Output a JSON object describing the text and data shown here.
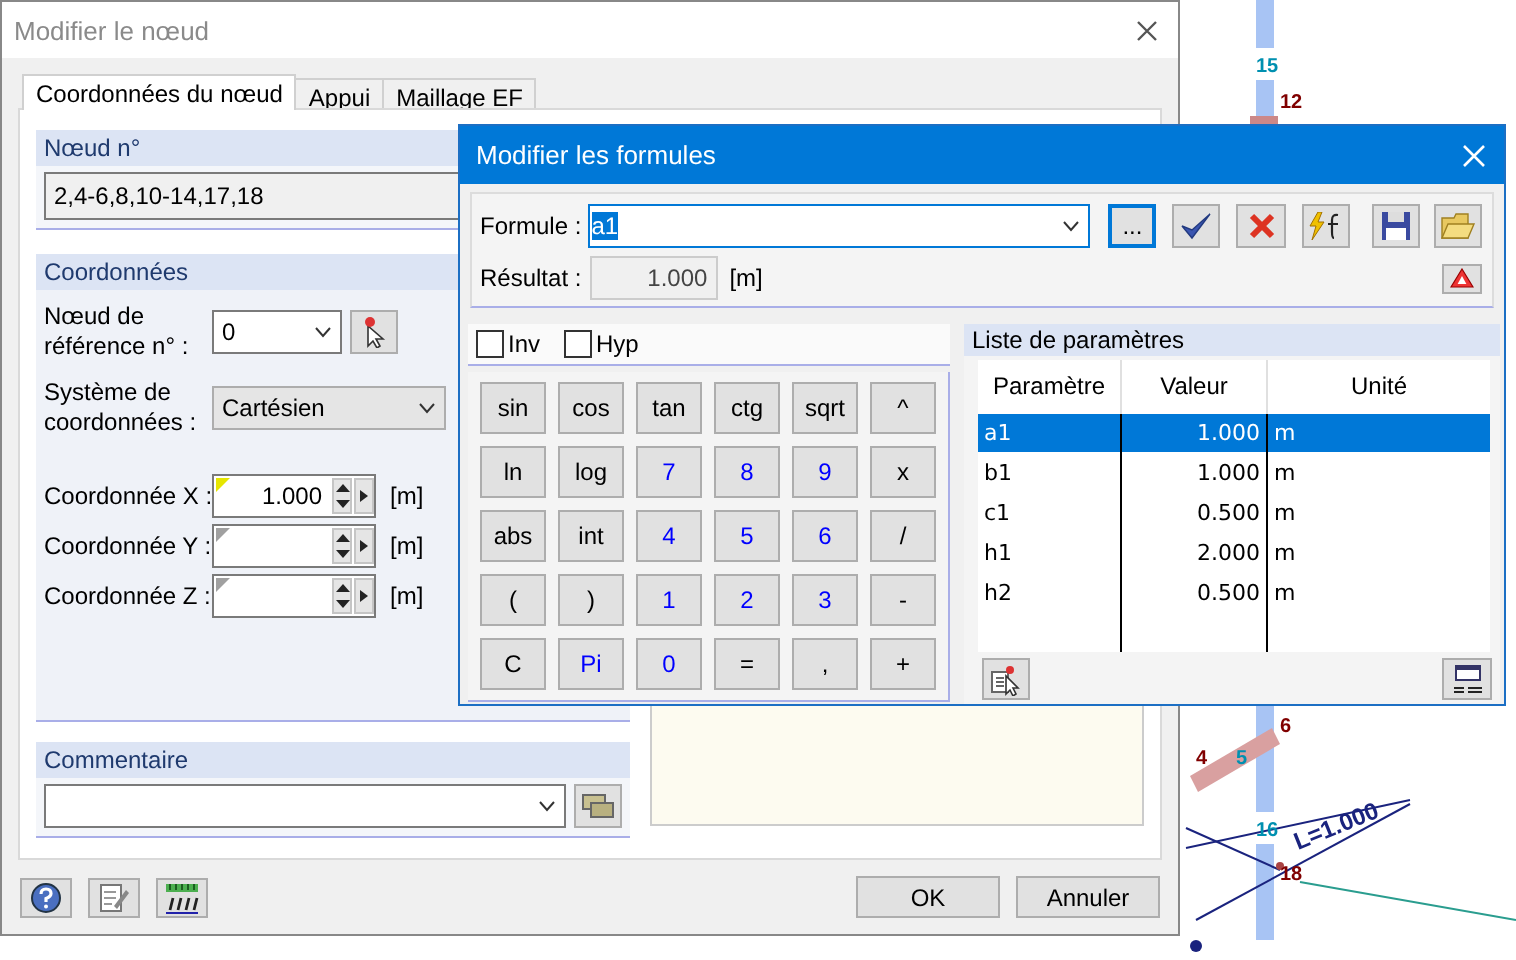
{
  "model_view": {
    "labels": [
      {
        "text": "15",
        "kind": "node"
      },
      {
        "text": "12",
        "kind": "member"
      },
      {
        "text": "6",
        "kind": "member"
      },
      {
        "text": "4",
        "kind": "member"
      },
      {
        "text": "5",
        "kind": "node"
      },
      {
        "text": "16",
        "kind": "node"
      },
      {
        "text": "18",
        "kind": "member"
      },
      {
        "text": "L=1.000",
        "kind": "dimension"
      }
    ]
  },
  "node_dialog": {
    "title": "Modifier le nœud",
    "tabs": [
      {
        "label": "Coordonnées du nœud",
        "selected": true
      },
      {
        "label": "Appui",
        "selected": false
      },
      {
        "label": "Maillage EF",
        "selected": false
      }
    ],
    "node_number": {
      "heading": "Nœud n°",
      "value": "2,4-6,8,10-14,17,18"
    },
    "coordinates": {
      "heading": "Coordonnées",
      "reference_node": {
        "label": "Nœud de référence n° :",
        "value": "0"
      },
      "system": {
        "label": "Système de coordonnées :",
        "value": "Cartésien"
      },
      "fields": [
        {
          "label": "Coordonnée X :",
          "value": "1.000",
          "unit": "[m]",
          "edited": true
        },
        {
          "label": "Coordonnée Y :",
          "unit": "[m]",
          "edited": false
        },
        {
          "label": "Coordonnée Z :",
          "unit": "[m]",
          "edited": false
        }
      ]
    },
    "comment": {
      "heading": "Commentaire"
    },
    "buttons": [
      "OK",
      "Annuler"
    ]
  },
  "formula_dialog": {
    "title": "Modifier les formules",
    "formula": {
      "label": "Formule :",
      "value": "a1"
    },
    "browse_button": "...",
    "result": {
      "label": "Résultat :",
      "value": "1.000",
      "unit": "[m]"
    },
    "options": [
      {
        "label": "Inv",
        "checked": false
      },
      {
        "label": "Hyp",
        "checked": false
      }
    ],
    "keys": [
      {
        "label": "sin",
        "kind": "function"
      },
      {
        "label": "cos",
        "kind": "function"
      },
      {
        "label": "tan",
        "kind": "function"
      },
      {
        "label": "ctg",
        "kind": "function"
      },
      {
        "label": "sqrt",
        "kind": "function"
      },
      {
        "label": "^",
        "kind": "operator"
      },
      {
        "label": "ln",
        "kind": "function"
      },
      {
        "label": "log",
        "kind": "function"
      },
      {
        "label": "7",
        "kind": "digit"
      },
      {
        "label": "8",
        "kind": "digit"
      },
      {
        "label": "9",
        "kind": "digit"
      },
      {
        "label": "x",
        "kind": "operator"
      },
      {
        "label": "abs",
        "kind": "function"
      },
      {
        "label": "int",
        "kind": "function"
      },
      {
        "label": "4",
        "kind": "digit"
      },
      {
        "label": "5",
        "kind": "digit"
      },
      {
        "label": "6",
        "kind": "digit"
      },
      {
        "label": "/",
        "kind": "operator"
      },
      {
        "label": "(",
        "kind": "operator"
      },
      {
        "label": ")",
        "kind": "operator"
      },
      {
        "label": "1",
        "kind": "digit"
      },
      {
        "label": "2",
        "kind": "digit"
      },
      {
        "label": "3",
        "kind": "digit"
      },
      {
        "label": "-",
        "kind": "operator"
      },
      {
        "label": "C",
        "kind": "function"
      },
      {
        "label": "Pi",
        "kind": "digit"
      },
      {
        "label": "0",
        "kind": "digit"
      },
      {
        "label": "=",
        "kind": "operator"
      },
      {
        "label": ",",
        "kind": "operator"
      },
      {
        "label": "+",
        "kind": "operator"
      }
    ],
    "parameters": {
      "heading": "Liste de paramètres",
      "columns": [
        "Paramètre",
        "Valeur",
        "Unité"
      ],
      "rows": [
        {
          "cells": [
            "a1",
            "1.000",
            "m"
          ],
          "selected": true
        },
        {
          "cells": [
            "b1",
            "1.000",
            "m"
          ],
          "selected": false
        },
        {
          "cells": [
            "c1",
            "0.500",
            "m"
          ],
          "selected": false
        },
        {
          "cells": [
            "h1",
            "2.000",
            "m"
          ],
          "selected": false
        },
        {
          "cells": [
            "h2",
            "0.500",
            "m"
          ],
          "selected": false
        }
      ]
    }
  }
}
